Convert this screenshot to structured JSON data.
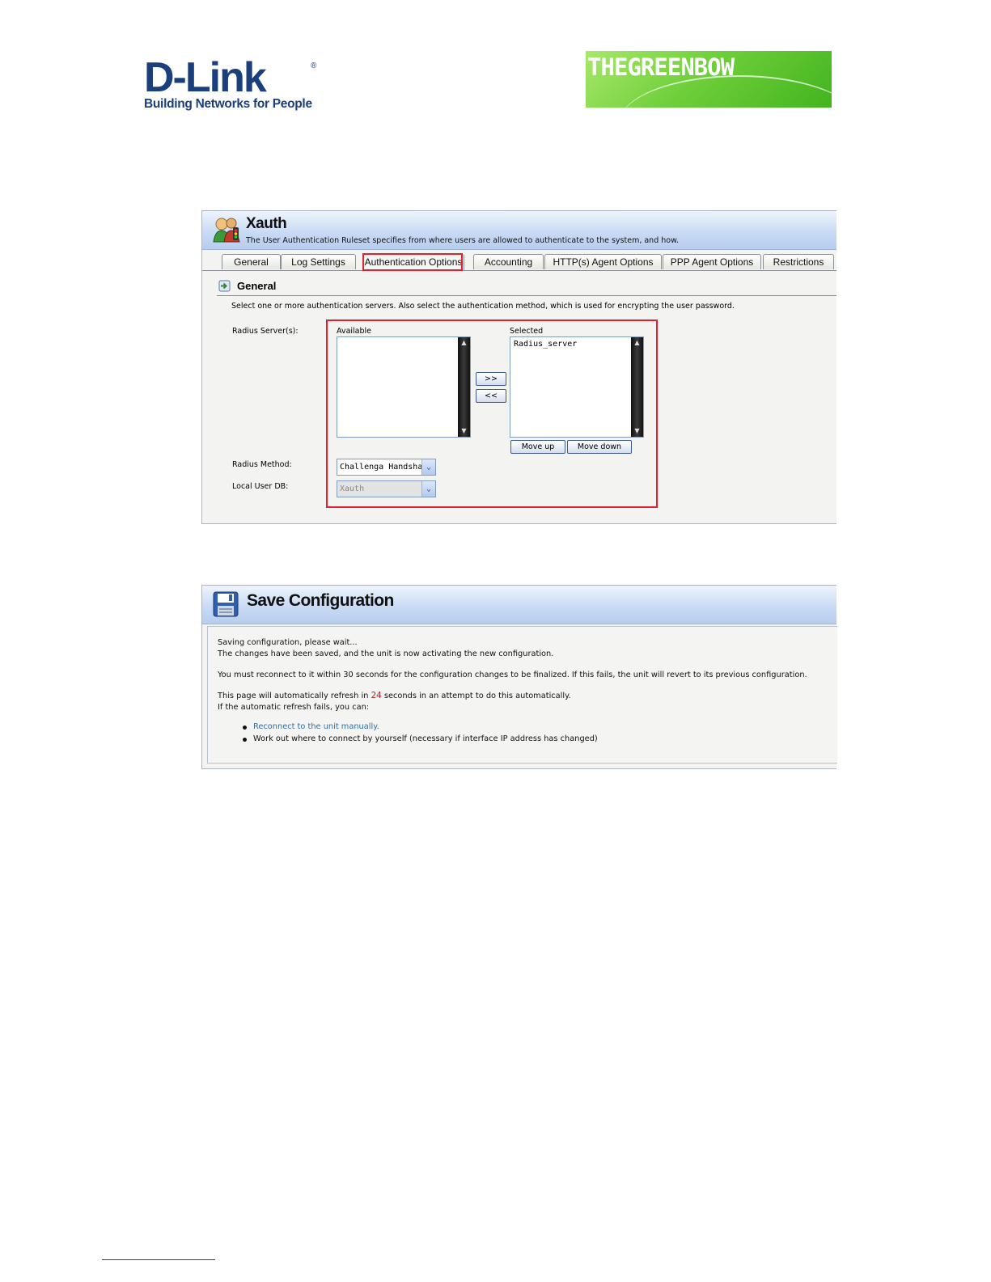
{
  "logos": {
    "dlink": {
      "word": "D-Link",
      "registered": "®",
      "tagline": "Building Networks for People"
    },
    "greenbow": {
      "word": "THEGREENBOW"
    }
  },
  "xauth": {
    "title": "Xauth",
    "description": "The User Authentication Ruleset specifies from where users are allowed to authenticate to the system, and how.",
    "tabs": [
      {
        "label": "General"
      },
      {
        "label": "Log Settings"
      },
      {
        "label": "Authentication Options",
        "active": true
      },
      {
        "label": "Accounting"
      },
      {
        "label": "HTTP(s) Agent Options"
      },
      {
        "label": "PPP Agent Options"
      },
      {
        "label": "Restrictions"
      }
    ],
    "section": {
      "title": "General",
      "description": "Select one or more authentication servers. Also select the authentication method, which is used for encrypting the user password."
    },
    "radius_servers": {
      "label": "Radius Server(s):",
      "available_caption": "Available",
      "selected_caption": "Selected",
      "available_items": [],
      "selected_items": [
        "Radius_server"
      ],
      "add_button": ">>",
      "remove_button": "<<",
      "move_up_button": "Move up",
      "move_down_button": "Move down"
    },
    "radius_method": {
      "label": "Radius Method:",
      "value": "Challenga Handshal"
    },
    "local_user_db": {
      "label": "Local User DB:",
      "value": "Xauth",
      "disabled": true
    }
  },
  "save": {
    "title": "Save Configuration",
    "line1": "Saving configuration, please wait...",
    "line2": "The changes have been saved, and the unit is now activating the new configuration.",
    "line3": "You must reconnect to it within 30 seconds for the configuration changes to be finalized. If this fails, the unit will revert to its previous configuration.",
    "refresh_prefix": "This page will automatically refresh in",
    "countdown": "24",
    "refresh_suffix": "seconds in an attempt to do this automatically.",
    "line5": "If the automatic refresh fails, you can:",
    "options": [
      "Reconnect to the unit manually.",
      "Work out where to connect by yourself (necessary if interface IP address has changed)"
    ]
  },
  "colors": {
    "highlight": "#e0202a",
    "header_blue": "#c9dbf4",
    "link": "#2f6fa8",
    "countdown": "#c8141e"
  }
}
